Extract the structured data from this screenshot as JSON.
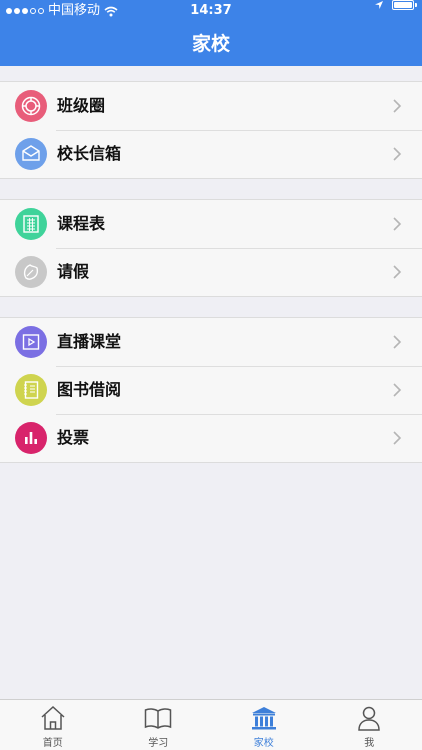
{
  "status": {
    "carrier": "中国移动",
    "time": "14:37"
  },
  "header": {
    "title": "家校"
  },
  "groups": [
    [
      {
        "label": "班级圈",
        "icon": "circle-target-icon",
        "color": "#e85d7a"
      },
      {
        "label": "校长信箱",
        "icon": "envelope-icon",
        "color": "#6ea0ea"
      }
    ],
    [
      {
        "label": "课程表",
        "icon": "calendar-grid-icon",
        "color": "#3fd39a"
      },
      {
        "label": "请假",
        "icon": "leaf-icon",
        "color": "#c8c8c8"
      }
    ],
    [
      {
        "label": "直播课堂",
        "icon": "play-icon",
        "color": "#7b6fe3"
      },
      {
        "label": "图书借阅",
        "icon": "notebook-icon",
        "color": "#cfd44f"
      },
      {
        "label": "投票",
        "icon": "bar-chart-icon",
        "color": "#d8246b"
      }
    ]
  ],
  "tabbar": {
    "tabs": [
      {
        "label": "首页",
        "icon": "home-icon",
        "active": false
      },
      {
        "label": "学习",
        "icon": "book-icon",
        "active": false
      },
      {
        "label": "家校",
        "icon": "school-icon",
        "active": true
      },
      {
        "label": "我",
        "icon": "person-icon",
        "active": false
      }
    ]
  }
}
